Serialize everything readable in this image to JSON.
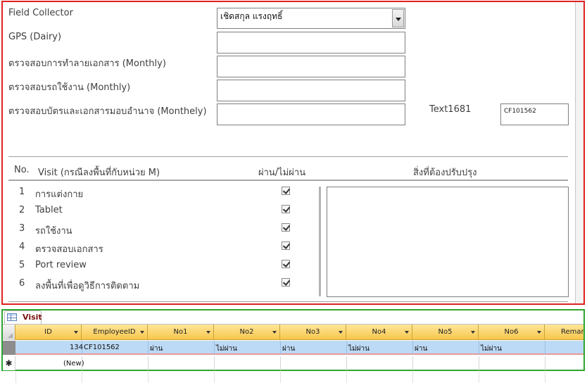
{
  "form": {
    "field_collector_label": "Field Collector",
    "field_collector_value": "เชิดสกุล แรงฤทธิ์",
    "gps_label": "GPS (Dairy)",
    "doc_check_label": "ตรวจสอบการทำลายเอกสาร (Monthly)",
    "car_check_label": "ตรวจสอบรถใช้งาน (Monthly)",
    "card_check_label": "ตรวจสอบบัตรและเอกสารมอบอำนาจ (Monthely)",
    "text1681_label": "Text1681",
    "text1681_value": "CF101562"
  },
  "visit_table": {
    "col_no": "No.",
    "col_visit": "Visit (กรณีลงพื้นที่กับหน่วย M)",
    "col_pass": "ผ่าน/ไม่ผ่าน",
    "col_improve": "สิ่งที่ต้องปรับปรุง",
    "items": [
      {
        "no": "1",
        "label": "การแต่งกาย",
        "checked": true
      },
      {
        "no": "2",
        "label": "Tablet",
        "checked": true
      },
      {
        "no": "3",
        "label": "รถใช้งาน",
        "checked": true
      },
      {
        "no": "4",
        "label": "ตรวจสอบเอกสาร",
        "checked": true
      },
      {
        "no": "5",
        "label": "Port review",
        "checked": true
      },
      {
        "no": "6",
        "label": "ลงพื้นที่เพื่อดูวิธีการติดตาม",
        "checked": true
      }
    ]
  },
  "datasheet": {
    "tab_label": "Visit",
    "columns": [
      "ID",
      "EmployeeID",
      "No1",
      "No2",
      "No3",
      "No4",
      "No5",
      "No6",
      "Remark"
    ],
    "row": {
      "id": "134",
      "employee_id": "CF101562",
      "no1": "ผ่าน",
      "no2": "ไม่ผ่าน",
      "no3": "ผ่าน",
      "no4": "ไม่ผ่าน",
      "no5": "ผ่าน",
      "no6": "ไม่ผ่าน"
    },
    "new_row_label": "(New)",
    "new_row_marker": "✱"
  },
  "colors": {
    "form_border": "#e02020",
    "datasheet_border": "#2fa52f",
    "header_gold": "#f7c64b",
    "row_selected": "#bcd9f5"
  }
}
